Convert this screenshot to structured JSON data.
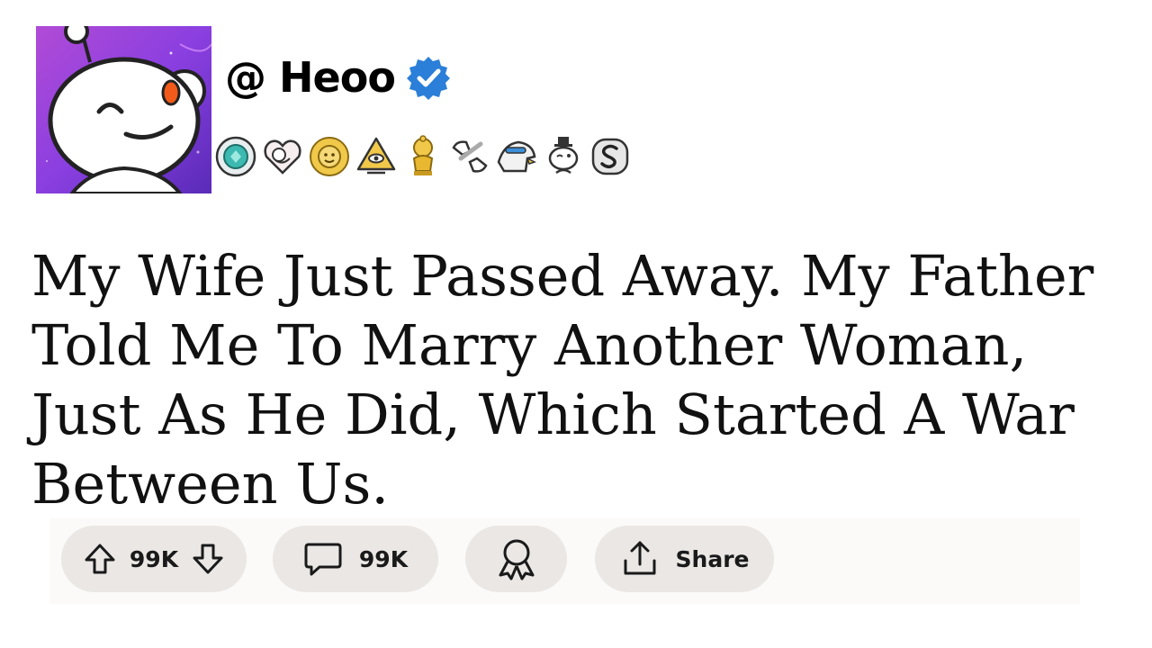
{
  "post": {
    "author": {
      "handle": "@ Heoo",
      "verified": true,
      "avatar_icon": "reddit-snoo-avatar-icon"
    },
    "awards": [
      "teal-gem-award-icon",
      "heart-award-icon",
      "sun-face-award-icon",
      "pyramid-eye-award-icon",
      "gold-snoo-trophy-award-icon",
      "fist-bump-award-icon",
      "eagle-award-icon",
      "snoo-top-hat-award-icon",
      "silver-s-award-icon"
    ],
    "title": "My Wife Just Passed Away. My Father Told Me To Marry Another Woman, Just As He Did, Which Started A War Between Us."
  },
  "actions": {
    "votes": "99K",
    "comments": "99K",
    "share_label": "Share"
  },
  "colors": {
    "avatar_background": "#8a3fe0",
    "verified_badge": "#2b7fd8",
    "pill_background": "#eae7e4",
    "text": "#111111"
  }
}
